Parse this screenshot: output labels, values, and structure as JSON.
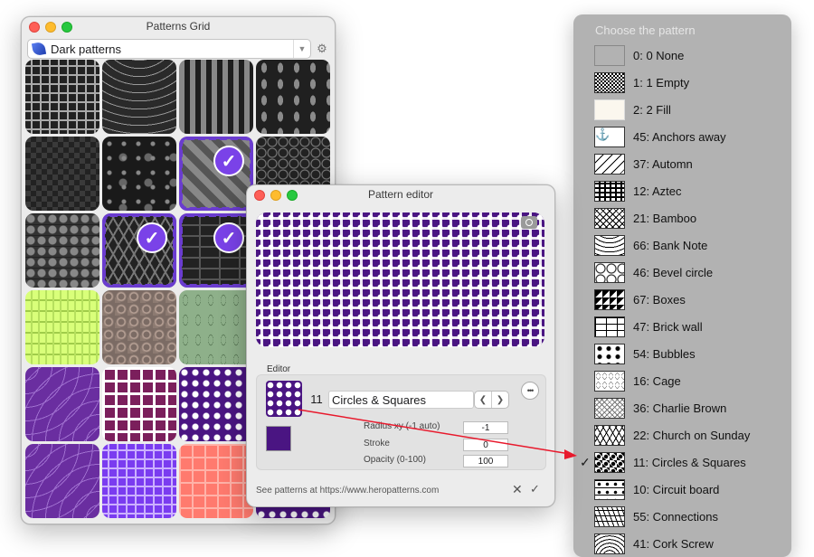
{
  "grid_window": {
    "title": "Patterns Grid",
    "selected_set": "Dark patterns",
    "tiles": [
      {
        "pattern": "greek",
        "selected": false
      },
      {
        "pattern": "waves",
        "selected": false
      },
      {
        "pattern": "bars",
        "selected": false
      },
      {
        "pattern": "leaves",
        "selected": false
      },
      {
        "pattern": "check",
        "selected": false
      },
      {
        "pattern": "dots",
        "selected": false
      },
      {
        "pattern": "stripes-sel",
        "selected": true
      },
      {
        "pattern": "circles-grid",
        "selected": false
      },
      {
        "pattern": "honey",
        "selected": false
      },
      {
        "pattern": "chevron",
        "selected": true
      },
      {
        "pattern": "brick",
        "selected": true
      },
      {
        "pattern": "circles-grid",
        "selected": false
      },
      {
        "pattern": "green-lime",
        "selected": false
      },
      {
        "pattern": "brown",
        "selected": false
      },
      {
        "pattern": "sage",
        "selected": false
      },
      {
        "pattern": "leaves",
        "selected": false
      },
      {
        "pattern": "purple-arcs",
        "selected": false
      },
      {
        "pattern": "squares-maroon",
        "selected": false
      },
      {
        "pattern": "circsq",
        "selected": false
      },
      {
        "pattern": "circsq",
        "selected": false
      },
      {
        "pattern": "purple-arcs",
        "selected": false
      },
      {
        "pattern": "violet-greek",
        "selected": false
      },
      {
        "pattern": "salmon",
        "selected": false
      },
      {
        "pattern": "circsq",
        "selected": false
      }
    ],
    "accent_color": "#6a3ccf"
  },
  "editor_window": {
    "title": "Pattern editor",
    "section_label": "Editor",
    "pattern_number": "11",
    "pattern_name": "Circles & Squares",
    "fill_color": "#4a1582",
    "params": [
      {
        "label": "Radius xy (-1 auto)",
        "value": "-1"
      },
      {
        "label": "Stroke",
        "value": "0"
      },
      {
        "label": "Opacity (0-100)",
        "value": "100"
      }
    ],
    "footer": "See patterns at https://www.heropatterns.com"
  },
  "menu": {
    "header": "Choose the pattern",
    "items": [
      {
        "label": "0: 0 None",
        "thumb": "none",
        "checked": false
      },
      {
        "label": "1: 1 Empty",
        "thumb": "empty",
        "checked": false
      },
      {
        "label": "2: 2 Fill",
        "thumb": "fill",
        "checked": false
      },
      {
        "label": "45: Anchors away",
        "thumb": "anchor",
        "checked": false
      },
      {
        "label": "37: Automn",
        "thumb": "autumn",
        "checked": false
      },
      {
        "label": "12: Aztec",
        "thumb": "aztec",
        "checked": false
      },
      {
        "label": "21: Bamboo",
        "thumb": "bamboo",
        "checked": false
      },
      {
        "label": "66: Bank Note",
        "thumb": "banknote",
        "checked": false
      },
      {
        "label": "46: Bevel circle",
        "thumb": "bevel",
        "checked": false
      },
      {
        "label": "67: Boxes",
        "thumb": "boxes",
        "checked": false
      },
      {
        "label": "47: Brick wall",
        "thumb": "brick",
        "checked": false
      },
      {
        "label": "54: Bubbles",
        "thumb": "bubbles",
        "checked": false
      },
      {
        "label": "16: Cage",
        "thumb": "cage",
        "checked": false
      },
      {
        "label": "36: Charlie Brown",
        "thumb": "charlie",
        "checked": false
      },
      {
        "label": "22: Church on Sunday",
        "thumb": "church",
        "checked": false
      },
      {
        "label": "11: Circles & Squares",
        "thumb": "circsq",
        "checked": true
      },
      {
        "label": "10: Circuit board",
        "thumb": "circuit",
        "checked": false
      },
      {
        "label": "55: Connections",
        "thumb": "conn",
        "checked": false
      },
      {
        "label": "41: Cork Screw",
        "thumb": "cork",
        "checked": false
      }
    ]
  },
  "arrow_color": "#e8192c"
}
